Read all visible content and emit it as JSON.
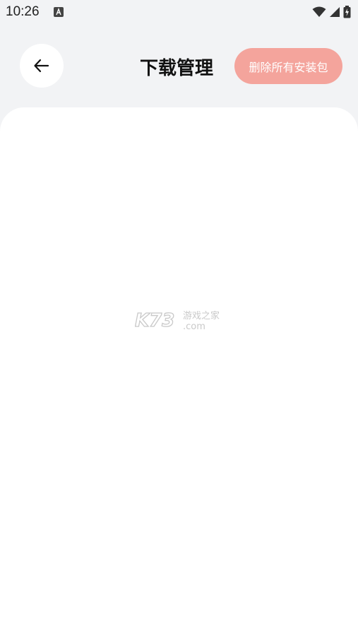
{
  "status_bar": {
    "time": "10:26",
    "icons": [
      "a-notification-icon",
      "wifi-icon",
      "cell-signal-icon",
      "battery-icon"
    ]
  },
  "header": {
    "back_icon": "arrow-left-icon",
    "title": "下载管理",
    "delete_all_label": "删除所有安装包"
  },
  "watermark": {
    "brand": "K73",
    "tagline": "游戏之家",
    "domain": ".com"
  },
  "colors": {
    "background": "#f2f3f5",
    "card": "#ffffff",
    "accent_button": "#f4a49c",
    "title_text": "#111111"
  }
}
